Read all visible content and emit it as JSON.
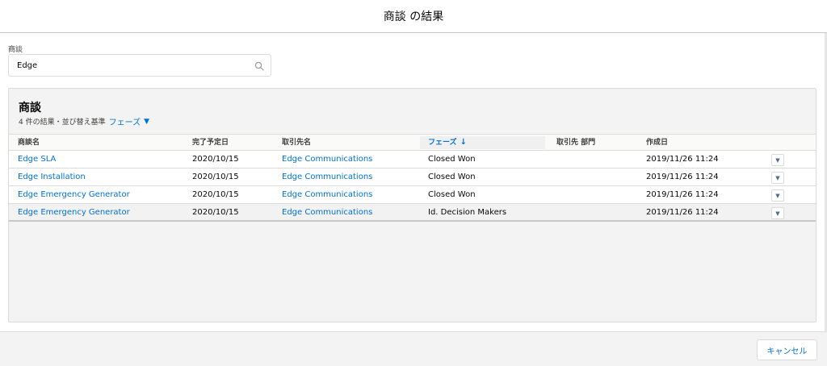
{
  "modal": {
    "title": "商談 の結果"
  },
  "search": {
    "label": "商談",
    "value": "Edge",
    "icon": "search-icon"
  },
  "results": {
    "title": "商談",
    "meta_text": "4 件の結果・並び替え基準",
    "sort_field": "フェーズ",
    "sort_caret": "▼"
  },
  "table": {
    "columns": [
      {
        "label": "商談名"
      },
      {
        "label": "完了予定日"
      },
      {
        "label": "取引先名"
      },
      {
        "label": "フェーズ",
        "sorted": true,
        "arrow": "↓"
      },
      {
        "label": "取引先 部門"
      },
      {
        "label": "作成日"
      }
    ],
    "rows": [
      {
        "name": "Edge SLA",
        "close_date": "2020/10/15",
        "account": "Edge Communications",
        "stage": "Closed Won",
        "division": "",
        "created": "2019/11/26 11:24"
      },
      {
        "name": "Edge Installation",
        "close_date": "2020/10/15",
        "account": "Edge Communications",
        "stage": "Closed Won",
        "division": "",
        "created": "2019/11/26 11:24"
      },
      {
        "name": "Edge Emergency Generator",
        "close_date": "2020/10/15",
        "account": "Edge Communications",
        "stage": "Closed Won",
        "division": "",
        "created": "2019/11/26 11:24"
      },
      {
        "name": "Edge Emergency Generator",
        "close_date": "2020/10/15",
        "account": "Edge Communications",
        "stage": "Id. Decision Makers",
        "division": "",
        "created": "2019/11/26 11:24"
      }
    ],
    "row_menu_glyph": "▼"
  },
  "footer": {
    "cancel_label": "キャンセル"
  },
  "colors": {
    "link": "#0070d2",
    "border": "#dddbda",
    "panel": "#f3f3f3"
  }
}
